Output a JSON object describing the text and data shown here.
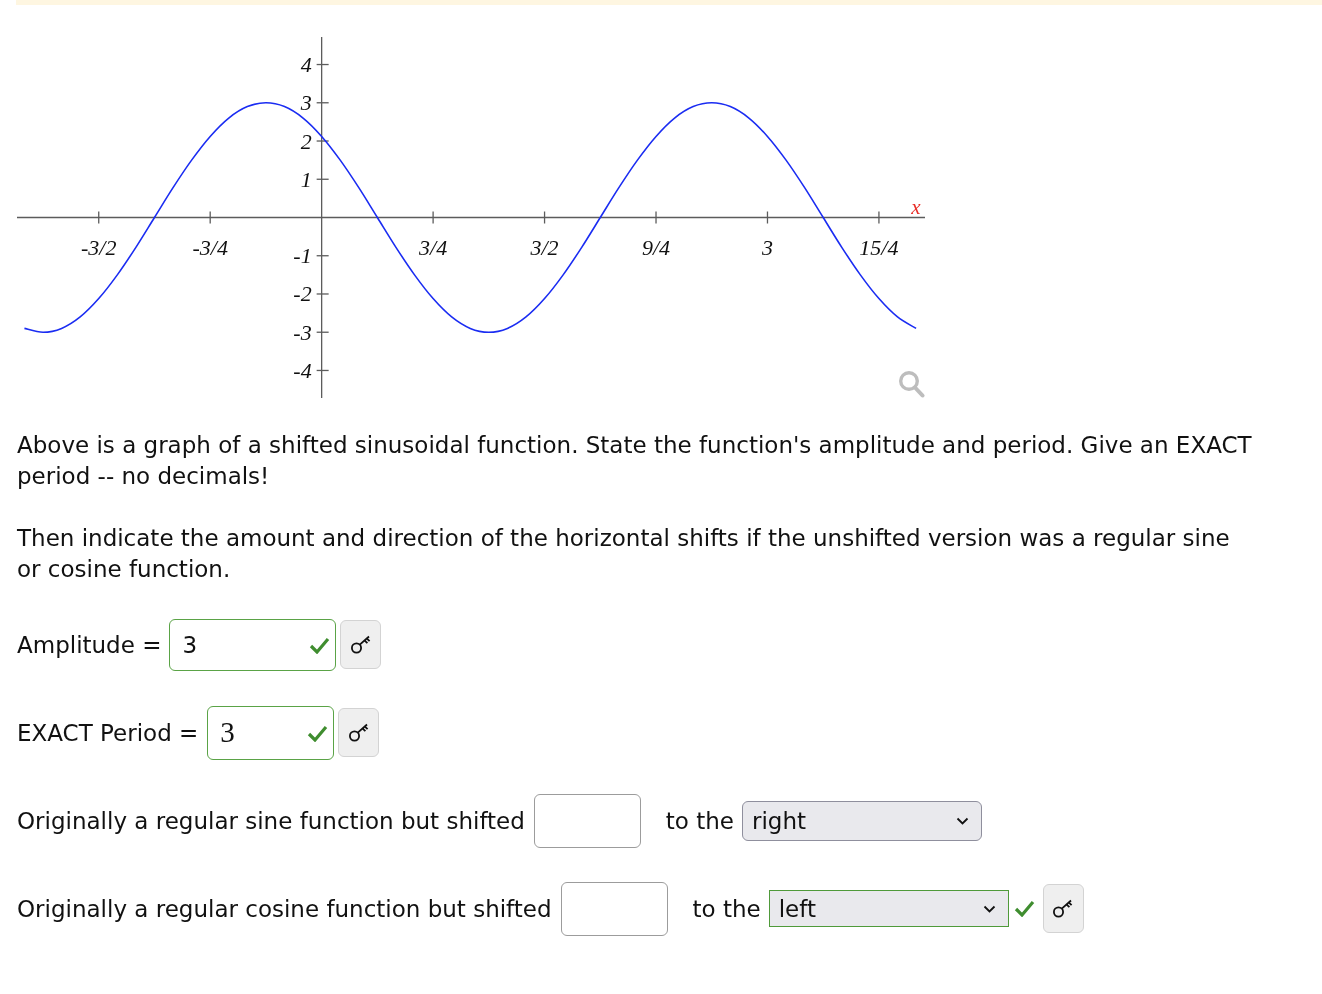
{
  "graph": {
    "chart_data": {
      "type": "line",
      "xlabel": "x",
      "x": [
        -2,
        -1.875,
        -1.75,
        -1.625,
        -1.5,
        -1.375,
        -1.25,
        -1.125,
        -1,
        -0.875,
        -0.75,
        -0.625,
        -0.5,
        -0.375,
        -0.25,
        -0.125,
        0,
        0.125,
        0.25,
        0.375,
        0.5,
        0.625,
        0.75,
        0.875,
        1,
        1.125,
        1.25,
        1.375,
        1.5,
        1.625,
        1.75,
        1.875,
        2,
        2.125,
        2.25,
        2.375,
        2.5,
        2.625,
        2.75,
        2.875,
        3,
        3.125,
        3.25,
        3.375,
        3.5,
        3.625,
        3.75,
        3.875,
        4
      ],
      "values": [
        -2.9,
        -3,
        -2.9,
        -2.6,
        -2.12,
        -1.5,
        -0.78,
        0,
        0.78,
        1.5,
        2.12,
        2.6,
        2.9,
        3,
        2.9,
        2.6,
        2.12,
        1.5,
        0.78,
        0,
        -0.78,
        -1.5,
        -2.12,
        -2.6,
        -2.9,
        -3,
        -2.9,
        -2.6,
        -2.12,
        -1.5,
        -0.78,
        0,
        0.78,
        1.5,
        2.12,
        2.6,
        2.9,
        3,
        2.9,
        2.6,
        2.12,
        1.5,
        0.78,
        0,
        -0.78,
        -1.5,
        -2.12,
        -2.6,
        -2.9
      ],
      "color": "#1a2cf2",
      "xlim": [
        -2.05,
        4.06
      ],
      "ylim": [
        -4.72,
        4.72
      ],
      "xticks": [
        {
          "value": -1.5,
          "label": "-3/2"
        },
        {
          "value": -0.75,
          "label": "-3/4"
        },
        {
          "value": 0.75,
          "label": "3/4"
        },
        {
          "value": 1.5,
          "label": "3/2"
        },
        {
          "value": 2.25,
          "label": "9/4"
        },
        {
          "value": 3,
          "label": "3"
        },
        {
          "value": 3.75,
          "label": "15/4"
        }
      ],
      "yticks": [
        -4,
        -3,
        -2,
        -1,
        1,
        2,
        3,
        4
      ]
    }
  },
  "question": {
    "paragraphs": [
      "Above is a graph of a shifted sinusoidal function. State the function's amplitude and period. Give an EXACT period -- no decimals!",
      "Then indicate the amount and direction of the horizontal shifts if the unshifted version was a regular sine or cosine function."
    ]
  },
  "answers": [
    {
      "kind": "input",
      "label": "Amplitude =",
      "field": {
        "kind": "text",
        "value": "3",
        "correct": true
      },
      "key_button": true
    },
    {
      "kind": "input",
      "label": "EXACT Period =",
      "field": {
        "kind": "math",
        "value": "3",
        "correct": true
      },
      "key_button": true
    },
    {
      "kind": "shift",
      "label": "Originally a regular sine function but shifted",
      "field": {
        "kind": "text",
        "correct": false
      },
      "direction_label": "to the",
      "direction": {
        "value": "right",
        "correct": false
      },
      "key_button": false
    },
    {
      "kind": "shift",
      "label": "Originally a regular cosine function but shifted",
      "field": {
        "kind": "text",
        "correct": false
      },
      "direction_label": "to the",
      "direction": {
        "value": "left",
        "correct": true
      },
      "key_button": true
    }
  ]
}
